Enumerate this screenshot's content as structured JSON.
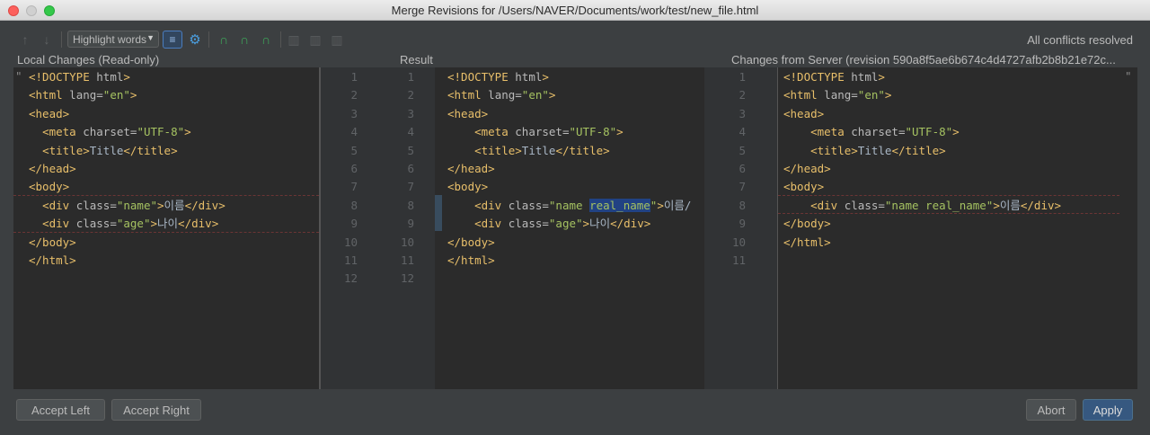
{
  "window": {
    "title": "Merge Revisions for /Users/NAVER/Documents/work/test/new_file.html"
  },
  "toolbar": {
    "prev_icon": "arrow-up-icon",
    "next_icon": "arrow-down-icon",
    "highlight_mode": "Highlight words",
    "status": "All conflicts resolved"
  },
  "panels": {
    "left_title": "Local Changes (Read-only)",
    "center_title": "Result",
    "right_title": "Changes from Server (revision 590a8f5ae6b674c4d4727afb2b8b21e72c..."
  },
  "left_code": [
    "<!DOCTYPE html>",
    "<html lang=\"en\">",
    "<head>",
    "  <meta charset=\"UTF-8\">",
    "  <title>Title</title>",
    "</head>",
    "<body>",
    "  <div class=\"name\">이름</div>",
    "  <div class=\"age\">나이</div>",
    "</body>",
    "</html>"
  ],
  "left_gutter": [
    "1",
    "2",
    "3",
    "4",
    "5",
    "6",
    "7",
    "8",
    "9",
    "10",
    "11",
    "12"
  ],
  "right_gutter": [
    "1",
    "2",
    "3",
    "4",
    "5",
    "6",
    "7",
    "8",
    "9",
    "10",
    "11",
    "12"
  ],
  "server_gutter": [
    "1",
    "2",
    "3",
    "4",
    "5",
    "6",
    "7",
    "8",
    "9",
    "10",
    "11"
  ],
  "result_code": [
    "<!DOCTYPE html>",
    "<html lang=\"en\">",
    "<head>",
    "    <meta charset=\"UTF-8\">",
    "    <title>Title</title>",
    "</head>",
    "<body>",
    "    <div class=\"name real_name\">이름</",
    "    <div class=\"age\">나이</div>",
    "</body>",
    "</html>"
  ],
  "server_code": [
    "<!DOCTYPE html>",
    "<html lang=\"en\">",
    "<head>",
    "    <meta charset=\"UTF-8\">",
    "    <title>Title</title>",
    "</head>",
    "<body>",
    "    <div class=\"name real_name\">이름</div>",
    "</body>",
    "</html>"
  ],
  "buttons": {
    "accept_left": "Accept Left",
    "accept_right": "Accept Right",
    "abort": "Abort",
    "apply": "Apply"
  },
  "colors": {
    "editor_bg": "#2b2b2b",
    "tag": "#e8bf6a",
    "attr_value": "#a5c261",
    "selection": "#214283",
    "primary_button": "#365880"
  }
}
